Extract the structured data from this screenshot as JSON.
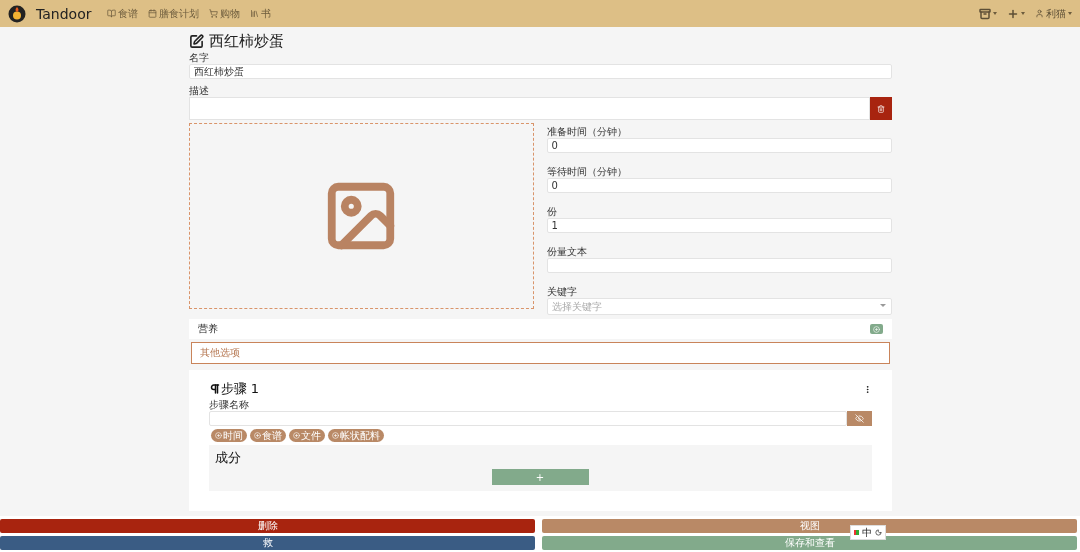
{
  "navbar": {
    "brand": "Tandoor",
    "links": [
      {
        "label": "食谱",
        "kind": "recipes"
      },
      {
        "label": "膳食计划",
        "kind": "plan"
      },
      {
        "label": "购物",
        "kind": "shopping"
      },
      {
        "label": "书",
        "kind": "books"
      }
    ],
    "right": [
      {
        "kind": "storage"
      },
      {
        "kind": "create"
      },
      {
        "kind": "user",
        "label": "利猫"
      }
    ]
  },
  "title": "西红柿炒蛋",
  "name": {
    "label": "名字",
    "value": "西红柿炒蛋"
  },
  "description": {
    "label": "描述"
  },
  "fields": [
    {
      "kind": "input",
      "label": "准备时间（分钟）",
      "value": "0"
    },
    {
      "kind": "input",
      "label": "等待时间（分钟）",
      "value": "0"
    },
    {
      "kind": "input",
      "label": "份",
      "value": "1"
    },
    {
      "kind": "input",
      "label": "份量文本"
    },
    {
      "kind": "select",
      "label": "关键字",
      "placeholder": "选择关键字"
    }
  ],
  "nutrition": {
    "title": "营养"
  },
  "other_options": "其他选项",
  "step": {
    "title": "步骤 1",
    "name_label": "步骤名称",
    "chips": [
      "时间",
      "食谱",
      "文件",
      "帐状配料"
    ],
    "ingredients_title": "成分",
    "add_label": "+"
  },
  "footer": [
    {
      "label": "删除",
      "color": "#a8240f"
    },
    {
      "label": "视图",
      "color": "#b98966"
    },
    {
      "label": "救",
      "color": "#3a5c84"
    },
    {
      "label": "保存和查看",
      "color": "#82aa8b"
    }
  ],
  "ime": {
    "label": "中"
  }
}
